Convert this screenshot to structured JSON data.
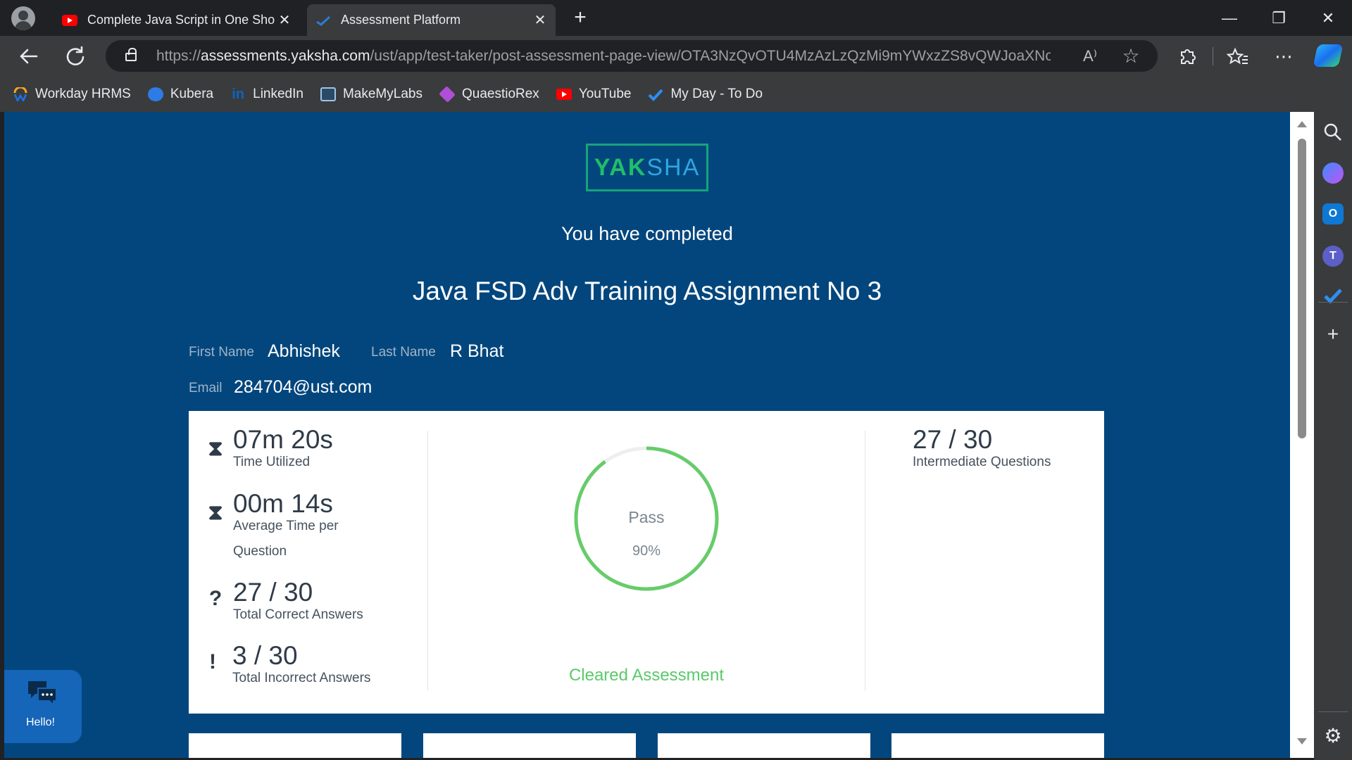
{
  "browser": {
    "tabs": [
      {
        "title": "Complete Java Script in One Shot",
        "icon": "youtube-icon"
      },
      {
        "title": "Assessment Platform",
        "icon": "yaksha-icon"
      }
    ],
    "close_glyph": "✕",
    "new_tab_glyph": "+",
    "window_controls": {
      "minimize": "—",
      "restore": "❐",
      "close": "✕"
    },
    "url_prefix": "https://",
    "url_host": "assessments.yaksha.com",
    "url_path": "/ust/app/test-taker/post-assessment-page-view/OTA3NzQvOTU4MzAzLzQzMi9mYWxzZS8vQWJoaXNoZ...",
    "read_aloud_glyph": "A⁾",
    "favorite_glyph": "☆",
    "bookmarks": [
      {
        "label": "Workday HRMS",
        "color": "#f5a623"
      },
      {
        "label": "Kubera",
        "color": "#2d7be5"
      },
      {
        "label": "LinkedIn",
        "color": "#0a66c2"
      },
      {
        "label": "MakeMyLabs",
        "color": "#9fc5e8"
      },
      {
        "label": "QuaestioRex",
        "color": "#b04fd6"
      },
      {
        "label": "YouTube",
        "color": "#ff0000"
      },
      {
        "label": "My Day - To Do",
        "color": "#2f8ef0"
      }
    ],
    "sidebar_plus": "+",
    "sidebar_settings": "⚙"
  },
  "logo": {
    "part1": "YAK",
    "part2": "SHA"
  },
  "heading": {
    "completed": "You have completed",
    "assessment": "Java FSD Adv Training Assignment No 3"
  },
  "candidate": {
    "first_name_label": "First Name",
    "first_name": "Abhishek",
    "last_name_label": "Last Name",
    "last_name": "R Bhat",
    "email_label": "Email",
    "email": "284704@ust.com"
  },
  "stats": {
    "time_utilized": {
      "value": "07m 20s",
      "label": "Time Utilized",
      "icon": "⧗"
    },
    "avg_time": {
      "value": "00m 14s",
      "label_line1": "Average Time per",
      "label_line2": "Question",
      "icon": "⧗"
    },
    "correct": {
      "value": "27 / 30",
      "label": "Total Correct Answers",
      "icon": "?"
    },
    "incorrect": {
      "value": "3 / 30",
      "label": "Total Incorrect Answers",
      "icon": "!"
    },
    "intermediate": {
      "value": "27 / 30",
      "label": "Intermediate Questions"
    }
  },
  "result": {
    "status": "Pass",
    "percent_text": "90%",
    "score_fraction": 0.9,
    "cleared_text": "Cleared Assessment",
    "ring_color": "#66cc6a",
    "track_color": "#eeeeee"
  },
  "chat": {
    "label": "Hello!"
  },
  "colors": {
    "page_bg": "#03467d",
    "accent_green": "#5bc96b"
  }
}
